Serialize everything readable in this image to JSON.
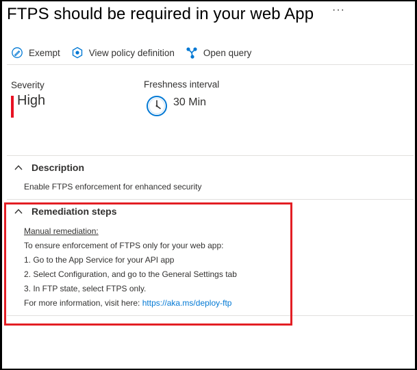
{
  "header": {
    "title": "FTPS should be required in your web App",
    "more": "···"
  },
  "toolbar": {
    "exempt": "Exempt",
    "view_policy": "View policy definition",
    "open_query": "Open query"
  },
  "severity": {
    "label": "Severity",
    "value": "High",
    "color": "#e81123"
  },
  "freshness": {
    "label": "Freshness interval",
    "value": "30 Min"
  },
  "description": {
    "heading": "Description",
    "text": "Enable FTPS enforcement for enhanced security"
  },
  "remediation": {
    "heading": "Remediation steps",
    "manual": "Manual remediation:",
    "intro": "To ensure enforcement of FTPS only for your web app:",
    "steps": [
      "1. Go to the App Service for your API app",
      "2. Select Configuration, and go to the General Settings tab",
      "3. In FTP state, select FTPS only."
    ],
    "more_info_prefix": "For more information, visit here: ",
    "more_info_link": "https://aka.ms/deploy-ftp"
  },
  "colors": {
    "accent": "#0078d4",
    "highlight_box": "#e31e24"
  },
  "icons": [
    "exempt-icon",
    "policy-icon",
    "query-icon",
    "clock-icon",
    "chevron-up-icon",
    "more-icon"
  ]
}
